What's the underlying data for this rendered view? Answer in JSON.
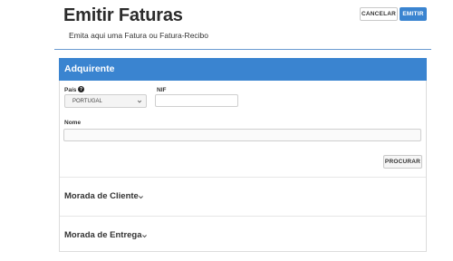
{
  "header": {
    "title": "Emitir Faturas",
    "subtitle": "Emita aqui uma Fatura ou Fatura-Recibo",
    "cancel_label": "CANCELAR",
    "emit_label": "EMITIR"
  },
  "card": {
    "title": "Adquirente",
    "country_label": "País",
    "country_value": "PORTUGAL",
    "nif_label": "NIF",
    "nif_value": "",
    "name_label": "Nome",
    "name_value": "",
    "search_label": "PROCURAR"
  },
  "sections": {
    "client_address": "Morada de Cliente",
    "delivery_address": "Morada de Entrega"
  },
  "icons": {
    "help": "question-circle-icon",
    "chevron": "chevron-down-icon"
  },
  "colors": {
    "primary": "#3a84d0",
    "text": "#333333"
  }
}
